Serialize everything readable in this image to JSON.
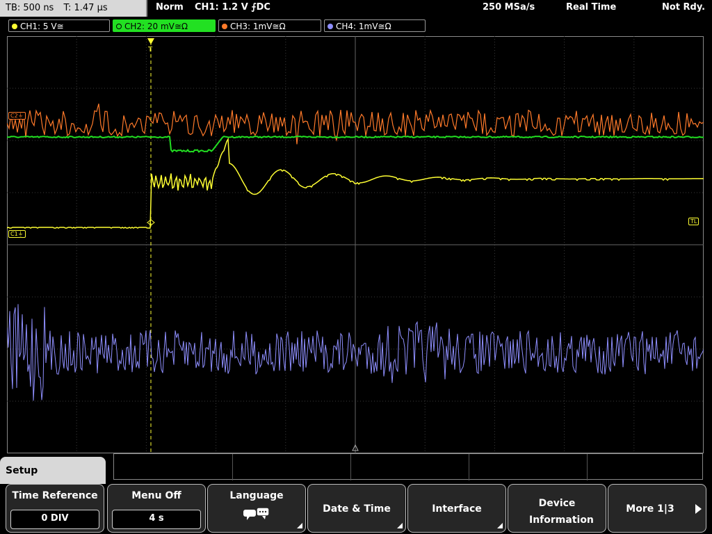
{
  "topbar": {
    "timebase": "TB: 500 ns",
    "trigger_time": "T: 1.47 µs",
    "mode": "Norm",
    "trigger_info": "CH1: 1.2 V ⨍DC",
    "sample_rate": "250 MSa/s",
    "acq_mode": "Real Time",
    "status": "Not Rdy."
  },
  "channels": [
    {
      "label": "CH1: 5 V≅",
      "color": "#ffff33"
    },
    {
      "label": "CH2: 20 mV≅Ω",
      "color": "#22e022"
    },
    {
      "label": "CH3: 1mV≅Ω",
      "color": "#ff7a2a"
    },
    {
      "label": "CH4: 1mV≅Ω",
      "color": "#8f8fff"
    }
  ],
  "markers": {
    "c2": "C2⏚",
    "c1": "C1⏚",
    "tl": "TL",
    "trig": "T"
  },
  "menu": {
    "title": "Setup",
    "softkeys": [
      {
        "label": "Time Reference",
        "value": "0 DIV"
      },
      {
        "label": "Menu Off",
        "value": "4 s"
      },
      {
        "label": "Language",
        "value": ""
      },
      {
        "label": "Date & Time",
        "value": ""
      },
      {
        "label": "Interface",
        "value": ""
      },
      {
        "label": "Device Information",
        "value": ""
      },
      {
        "label": "More 1|3",
        "value": ""
      }
    ]
  },
  "icons": [
    "speech-bubble-icon",
    "submenu-triangle-icon",
    "next-arrow-icon"
  ]
}
